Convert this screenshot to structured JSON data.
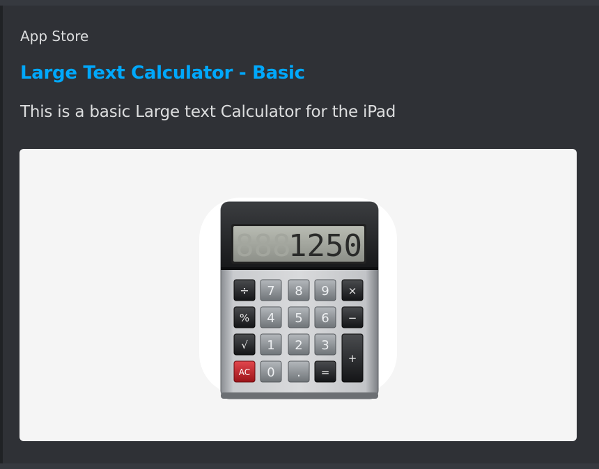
{
  "embed": {
    "provider": "App Store",
    "title": "Large Text Calculator - Basic",
    "description": "This is a basic Large text Calculator for the iPad"
  },
  "icon": {
    "name": "calculator-icon",
    "display": {
      "ghost": "888",
      "value": "1250"
    },
    "keys": {
      "row1": [
        "÷",
        "7",
        "8",
        "9",
        "×"
      ],
      "row2": [
        "%",
        "4",
        "5",
        "6",
        "−"
      ],
      "row3": [
        "√",
        "1",
        "2",
        "3",
        "+"
      ],
      "row4": [
        "AC",
        "0",
        ".",
        "="
      ]
    }
  },
  "colors": {
    "link": "#00a8fc",
    "embed_background": "#2f3136",
    "ac_key": "#c8212b"
  }
}
